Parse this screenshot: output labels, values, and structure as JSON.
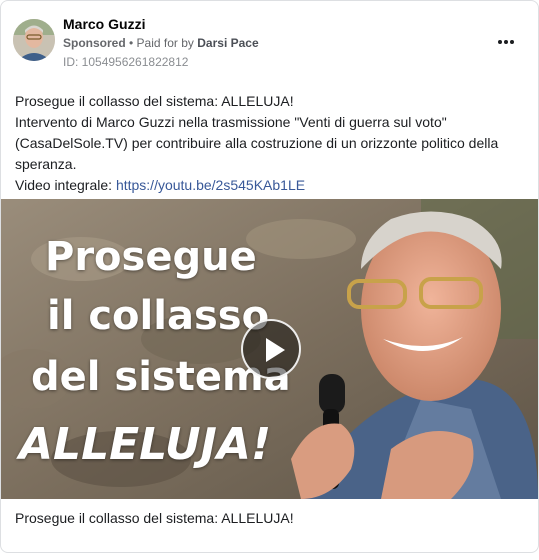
{
  "post": {
    "author": "Marco Guzzi",
    "sponsored": "Sponsored",
    "separator": " • ",
    "paid_for_by": "Paid for by",
    "payer": "Darsi Pace",
    "ad_id": "ID: 1054956261822812"
  },
  "body": {
    "line1": "Prosegue il collasso del sistema: ALLELUJA!",
    "line2": "Intervento di Marco Guzzi nella trasmissione \"Venti di guerra sul voto\" (CasaDelSole.TV) per contribuire alla costruzione di un orizzonte politico della speranza.",
    "video_prefix": "Video integrale: ",
    "video_link": "https://youtu.be/2s545KAb1LE"
  },
  "media": {
    "overlay_line1": "Prosegue",
    "overlay_line2": "il collasso",
    "overlay_line3": "del sistema",
    "overlay_line4": "ALLELUJA!"
  },
  "caption": "Prosegue il collasso del sistema: ALLELUJA!",
  "icons": {
    "more": "more-horizontal-icon",
    "play": "play-icon"
  },
  "colors": {
    "link": "#385898",
    "secondary_text": "#65676b",
    "border": "#dddfe2"
  }
}
